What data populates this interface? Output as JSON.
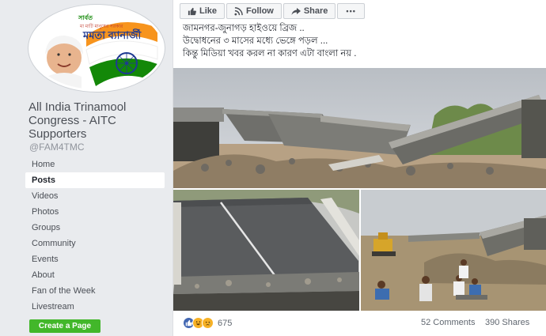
{
  "sidebar": {
    "avatar_caption_top": "সার্বত",
    "avatar_caption_sub": "মা মাটি মানুষের সরকার",
    "avatar_name": "মমতা ব্যানার্জী",
    "page_name": "All India Trinamool Congress - AITC Supporters",
    "page_handle": "@FAM4TMC",
    "nav": [
      "Home",
      "Posts",
      "Videos",
      "Photos",
      "Groups",
      "Community",
      "Events",
      "About",
      "Fan of the Week",
      "Livestream"
    ],
    "active_nav": "Posts",
    "create_page": "Create a Page"
  },
  "topbar": {
    "like": "Like",
    "follow": "Follow",
    "share": "Share",
    "more": "•••"
  },
  "post": {
    "lines": [
      "জামনগর-জুনাগড় হাইওয়ে ব্রিজ ..",
      "উদ্বোধনের ৩ মাসের মধ্যে ভেঙ্গে পড়ল ...",
      "কিন্তু মিডিয়া খবর করল না কারণ এটা বাংলা নয় ."
    ],
    "reaction_icons": [
      "like-reaction-icon",
      "haha-reaction-icon",
      "sad-reaction-icon"
    ],
    "reaction_count": "675",
    "comments": "52 Comments",
    "shares": "390 Shares"
  },
  "colors": {
    "facebook_bg": "#e9ebee",
    "like_blue": "#4267b2",
    "create_green": "#42b72a",
    "saffron": "#f7941d",
    "india_green": "#138808"
  }
}
